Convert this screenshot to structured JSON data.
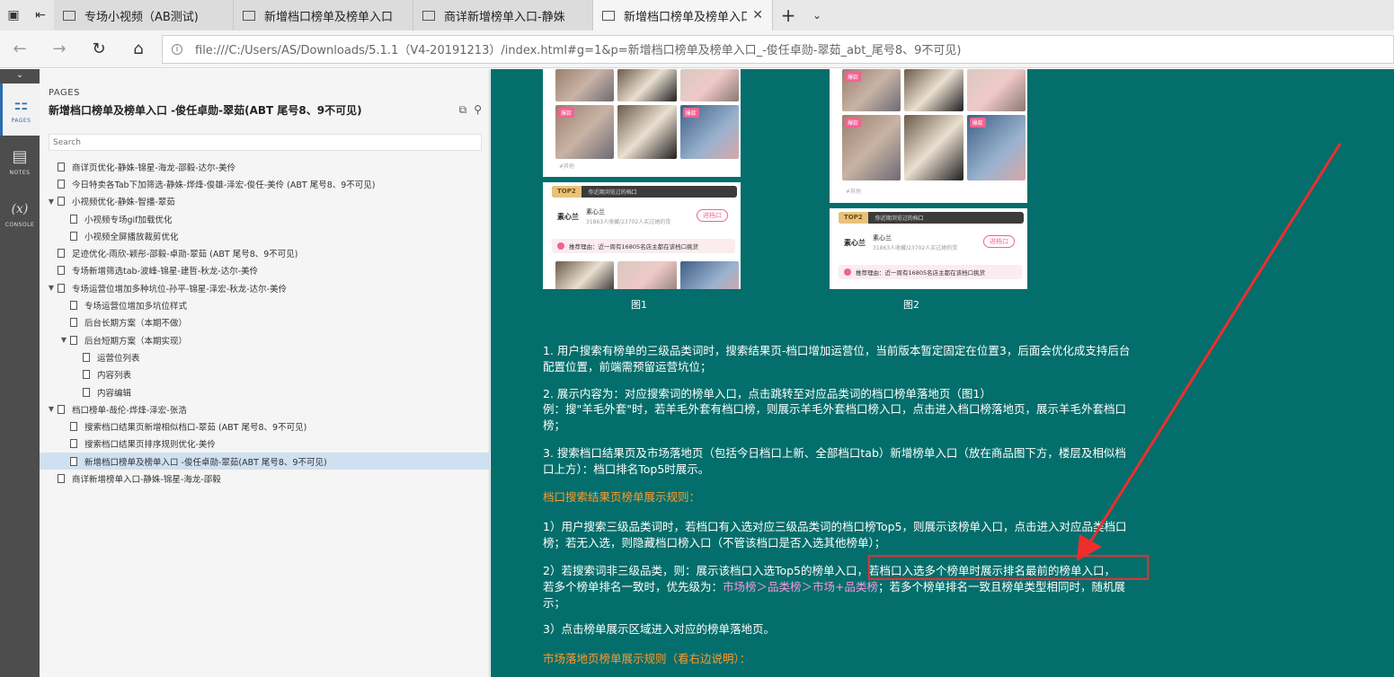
{
  "tabs": [
    {
      "label": "专场小视频（AB测试)",
      "active": false
    },
    {
      "label": "新增档口榜单及榜单入口",
      "active": false
    },
    {
      "label": "商详新增榜单入口-静姝",
      "active": false
    },
    {
      "label": "新增档口榜单及榜单入口",
      "active": true
    }
  ],
  "address": {
    "url": "file:///C:/Users/AS/Downloads/5.1.1（V4-20191213）/index.html#g=1&p=新增档口榜单及榜单入口_-俊任卓勋-翠茹_abt_尾号8、9不可见)"
  },
  "rail": {
    "items": [
      {
        "label": "PAGES",
        "icon": "sitemap-icon"
      },
      {
        "label": "NOTES",
        "icon": "notes-icon"
      },
      {
        "label": "CONSOLE",
        "icon": "console-icon",
        "glyph": "(x)"
      }
    ]
  },
  "panel": {
    "section_label": "PAGES",
    "title": "新增档口榜单及榜单入口 -俊任卓勋-翠茹(ABT 尾号8、9不可见)",
    "search_placeholder": "Search",
    "tree": [
      {
        "label": "商详页优化-静姝-锦星-海龙-邵毅-达尔-美伶",
        "level": 0,
        "expand": ""
      },
      {
        "label": "今日特卖各Tab下加筛选-静姝-烨烽-俊雄-泽宏-俊任-美伶 (ABT 尾号8、9不可见)",
        "level": 0,
        "expand": ""
      },
      {
        "label": "小视频优化-静姝-智播-翠茹",
        "level": 0,
        "expand": "▼"
      },
      {
        "label": "小视频专场gif加载优化",
        "level": 1,
        "expand": ""
      },
      {
        "label": "小视频全屏播放裁剪优化",
        "level": 1,
        "expand": ""
      },
      {
        "label": "足迹优化-雨欣-颖彤-邵毅-卓勋-翠茹 (ABT 尾号8、9不可见)",
        "level": 0,
        "expand": ""
      },
      {
        "label": "专场新增筛选tab-波峰-锦星-建哲-秋龙-达尔-美伶",
        "level": 0,
        "expand": ""
      },
      {
        "label": "专场运营位增加多种坑位-孙平-锦星-泽宏-秋龙-达尔-美伶",
        "level": 0,
        "expand": "▼"
      },
      {
        "label": "专场运营位增加多坑位样式",
        "level": 1,
        "expand": ""
      },
      {
        "label": "后台长期方案（本期不做）",
        "level": 1,
        "expand": ""
      },
      {
        "label": "后台短期方案（本期实现）",
        "level": 1,
        "expand": "▼"
      },
      {
        "label": "运营位列表",
        "level": 2,
        "expand": ""
      },
      {
        "label": "内容列表",
        "level": 2,
        "expand": ""
      },
      {
        "label": "内容编辑",
        "level": 2,
        "expand": ""
      },
      {
        "label": "档口榜单-哉伦-烨烽-泽宏-张浩",
        "level": 0,
        "expand": "▼"
      },
      {
        "label": "搜索档口结果页新增相似档口-翠茹 (ABT 尾号8、9不可见)",
        "level": 1,
        "expand": ""
      },
      {
        "label": "搜索档口结果页排序规则优化-美伶",
        "level": 1,
        "expand": ""
      },
      {
        "label": "新增档口榜单及榜单入口 -俊任卓勋-翠茹(ABT 尾号8、9不可见)",
        "level": 1,
        "expand": "",
        "selected": true
      },
      {
        "label": "商详新增榜单入口-静姝-锦星-海龙-邵毅",
        "level": 0,
        "expand": ""
      }
    ]
  },
  "content": {
    "phones": [
      {
        "caption": "图1",
        "badges": [
          "爆款",
          "爆款"
        ],
        "other_tag": "#其他"
      },
      {
        "caption": "图2",
        "badges": [
          "爆款",
          "爆款",
          "爆款"
        ],
        "other_tag": "#其他"
      }
    ],
    "card": {
      "rank": "TOP2",
      "hint": "你近期浏览过的档口",
      "shop": "素心兰",
      "shop_title": "素心兰",
      "shop_sub": "31863人收藏/23702人买过她的货",
      "enter": "进档口",
      "reason": "推荐理由：近一周有16805名店主都在该档口挑货"
    },
    "p1": "1. 用户搜索有榜单的三级品类词时，搜索结果页-档口增加运营位，当前版本暂定固定在位置3，后面会优化成支持后台配置位置，前端需预留运营坑位；",
    "p2a": "2. 展示内容为：对应搜索词的榜单入口，点击跳转至对应品类词的档口榜单落地页（图1）",
    "p2b": "例：搜\"羊毛外套\"时，若羊毛外套有档口榜，则展示羊毛外套档口榜入口，点击进入档口榜落地页，展示羊毛外套档口榜；",
    "p3": "3. 搜索档口结果页及市场落地页（包括今日档口上新、全部档口tab）新增榜单入口（放在商品图下方，楼层及相似档口上方）：档口排名Top5时展示。",
    "h1": "档口搜索结果页榜单展示规则：",
    "r1": "1）用户搜索三级品类词时，若档口有入选对应三级品类词的档口榜Top5，则展示该榜单入口，点击进入对应品类档口榜；若无入选，则隐藏档口榜入口（不管该档口是否入选其他榜单）；",
    "r2a": "2）若搜索词非三级品类，则：展示该档口入选Top5的榜单入口，若档口入选多个榜单时展示排名最前的榜单入口，",
    "r2b": "若多个榜单排名一致时，优先级为：",
    "r2c": "市场榜＞品类榜＞市场+品类榜",
    "r2d": "；若多个榜单排名一致且榜单类型相同时，随机展示；",
    "r3": "3）点击榜单展示区域进入对应的榜单落地页。",
    "h2": "市场落地页榜单展示规则（看右边说明）："
  },
  "colors": {
    "content_bg": "#036e6b",
    "annotation": "#ef2d2d",
    "heading": "#ff9a2e",
    "priority": "#f29adf"
  }
}
